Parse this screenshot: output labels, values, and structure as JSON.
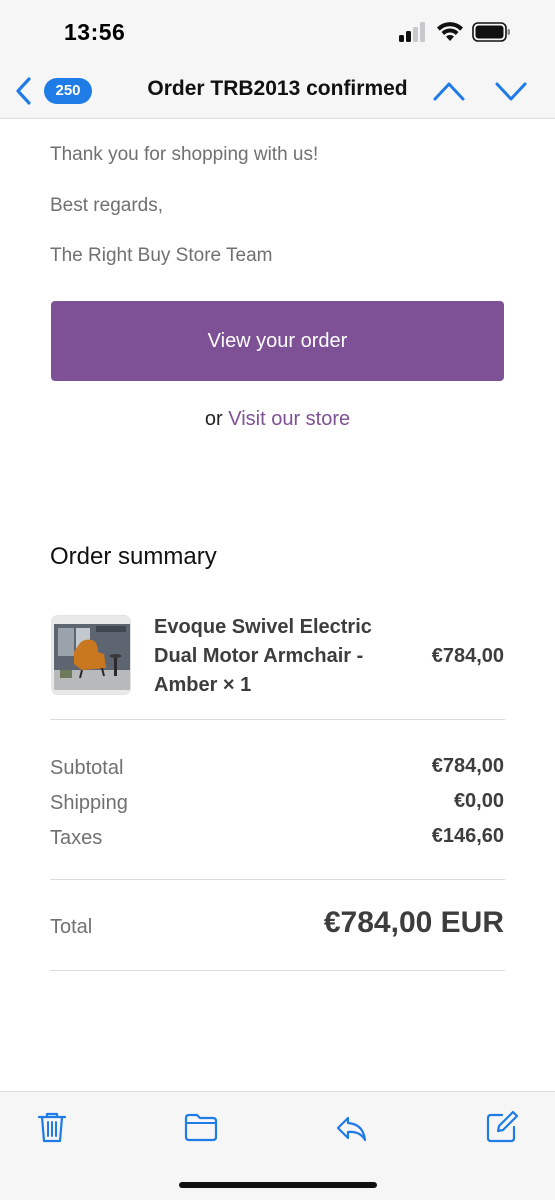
{
  "status_bar": {
    "time": "13:56"
  },
  "nav": {
    "back_icon": "chevron-left-icon",
    "unread_count": "250",
    "title": "Order TRB2013 confirmed",
    "prev_icon": "chevron-up-icon",
    "next_icon": "chevron-down-icon"
  },
  "message": {
    "lines": [
      "Thank you for shopping with us!",
      "Best regards,",
      "The Right Buy Store Team"
    ],
    "cta_label": "View your order",
    "alt_prefix": "or",
    "alt_link": "Visit our store"
  },
  "order_summary": {
    "heading": "Order summary",
    "item": {
      "name": "Evoque Swivel Electric Dual Motor Armchair - Amber × 1",
      "price": "€784,00"
    },
    "costs": [
      {
        "label": "Subtotal",
        "value": "€784,00"
      },
      {
        "label": "Shipping",
        "value": "€0,00"
      },
      {
        "label": "Taxes",
        "value": "€146,60"
      }
    ],
    "total_label": "Total",
    "total_value": "€784,00 EUR"
  },
  "toolbar": {
    "icons": [
      "trash-icon",
      "folder-icon",
      "reply-icon",
      "compose-icon"
    ]
  },
  "colors": {
    "accent_blue": "#1f7be6",
    "brand_purple": "#7e5197",
    "bar_background": "#f6f6f7"
  }
}
